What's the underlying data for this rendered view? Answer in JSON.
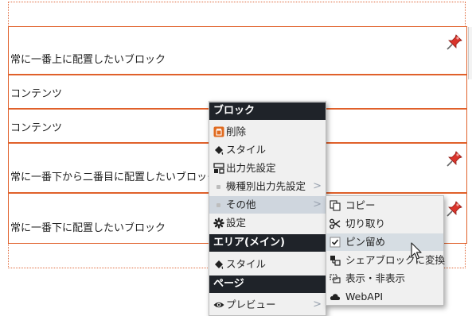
{
  "blocks": [
    {
      "text": "常に一番上に配置したいブロック",
      "pinned": true
    },
    {
      "text": "コンテンツ",
      "pinned": false
    },
    {
      "text": "コンテンツ",
      "pinned": false
    },
    {
      "text": "常に一番下から二番目に配置したいブロック",
      "pinned": true
    },
    {
      "text": "常に一番下に配置したいブロック",
      "pinned": true
    }
  ],
  "context_menu": {
    "block_header": "ブロック",
    "delete": "削除",
    "style": "スタイル",
    "output_target": "出力先設定",
    "device_output_target": "機種別出力先設定",
    "other": "その他",
    "settings": "設定",
    "area_header": "エリア(メイン)",
    "area_style": "スタイル",
    "page_header": "ページ",
    "preview": "プレビュー",
    "arrow": ">"
  },
  "submenu": {
    "copy": "コピー",
    "cut": "切り取り",
    "pin": "ピン留め",
    "share_convert": "シェアブロックに変換",
    "show_hide": "表示・非表示",
    "webapi": "WebAPI"
  },
  "colors": {
    "block_border": "#e0602a",
    "menu_header_bg": "#1f2329",
    "menu_bg": "#f0f0f0",
    "highlight": "#cfd6de",
    "pin_red": "#d9342b"
  },
  "icons": {
    "pin": "pushpin-icon",
    "delete": "trash-icon",
    "style": "paint-bucket-icon",
    "output": "output-target-icon",
    "settings": "gear-icon",
    "preview": "eye-icon",
    "copy": "copy-icon",
    "cut": "scissors-icon",
    "pin_check": "checkbox-icon",
    "share": "share-block-icon",
    "show_hide": "show-hide-icon",
    "webapi": "cloud-icon"
  }
}
